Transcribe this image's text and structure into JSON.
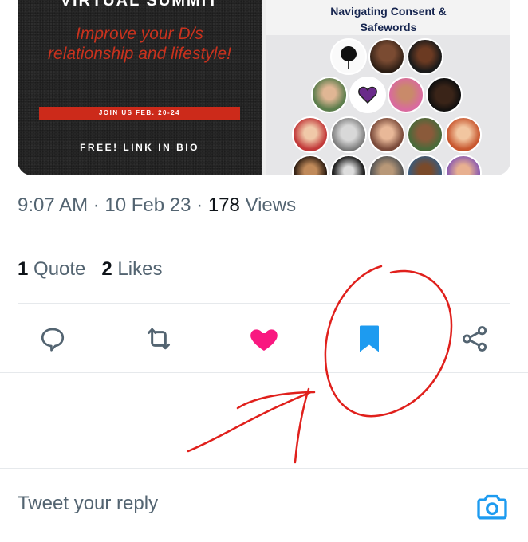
{
  "media": {
    "poster": {
      "top_text": "VIRTUAL SUMMIT",
      "tagline": "Improve your D/s relationship and lifestyle!",
      "join": "JOIN US FEB. 20-24",
      "free": "FREE! LINK IN BIO"
    },
    "panel": {
      "title_line1": "Navigating Consent &",
      "title_line2": "Safewords"
    }
  },
  "tweet_meta": {
    "time": "9:07 AM",
    "sep1": " · ",
    "date": "10 Feb 23",
    "sep2": " · ",
    "views_count": "178",
    "views_label": " Views"
  },
  "stats": {
    "quotes_count": "1",
    "quotes_label": " Quote",
    "likes_count": "2",
    "likes_label": " Likes"
  },
  "colors": {
    "like_active": "#f91880",
    "bookmark_active": "#1d9bf0",
    "icon_gray": "#536471",
    "annotation": "#e0201c"
  },
  "actions": [
    "reply-icon",
    "retweet-icon",
    "heart-icon",
    "bookmark-icon",
    "share-icon"
  ],
  "reply": {
    "placeholder": "Tweet your reply"
  }
}
